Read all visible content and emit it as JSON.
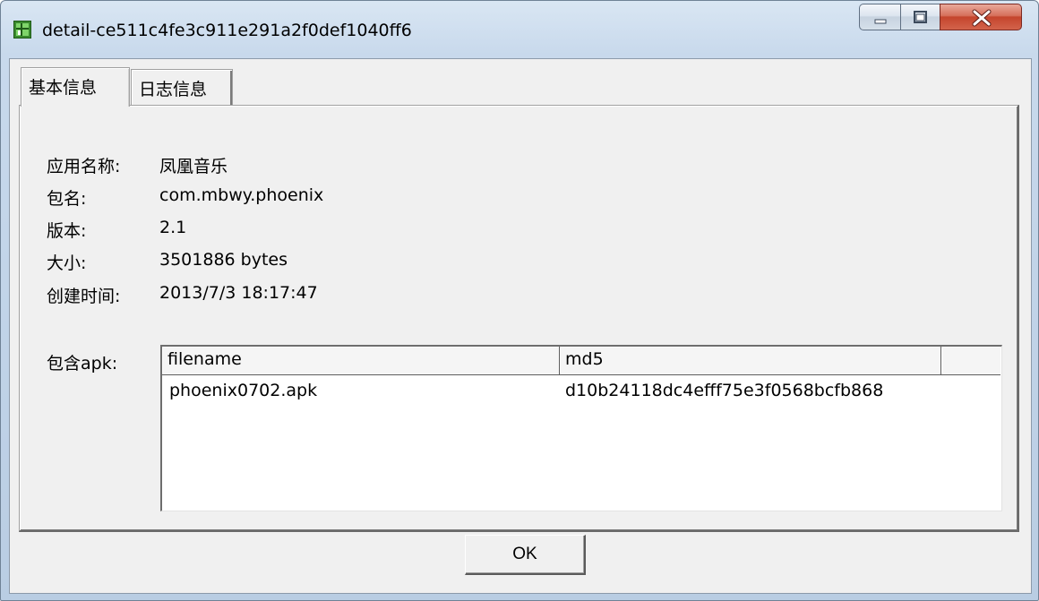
{
  "window": {
    "title": "detail-ce511c4fe3c911e291a2f0def1040ff6",
    "icon": "grid-app-icon",
    "controls": {
      "minimize": "minimize-icon",
      "maximize": "maximize-icon",
      "close": "close-icon"
    }
  },
  "tabs": [
    {
      "label": "基本信息",
      "active": true
    },
    {
      "label": "日志信息",
      "active": false
    }
  ],
  "basic_info": {
    "app_name_label": "应用名称:",
    "app_name_value": "凤凰音乐",
    "package_label": "包名:",
    "package_value": "com.mbwy.phoenix",
    "version_label": "版本:",
    "version_value": "2.1",
    "size_label": "大小:",
    "size_value": "3501886 bytes",
    "created_label": "创建时间:",
    "created_value": "2013/7/3 18:17:47",
    "apk_label": "包含apk:"
  },
  "apk_table": {
    "columns": [
      "filename",
      "md5",
      ""
    ],
    "rows": [
      {
        "filename": "phoenix0702.apk",
        "md5": "d10b24118dc4efff75e3f0568bcfb868"
      }
    ]
  },
  "footer": {
    "ok_label": "OK"
  },
  "colors": {
    "close_button": "#c4452d",
    "client_bg": "#f0f0f0",
    "frame": "#c8d9ec"
  }
}
